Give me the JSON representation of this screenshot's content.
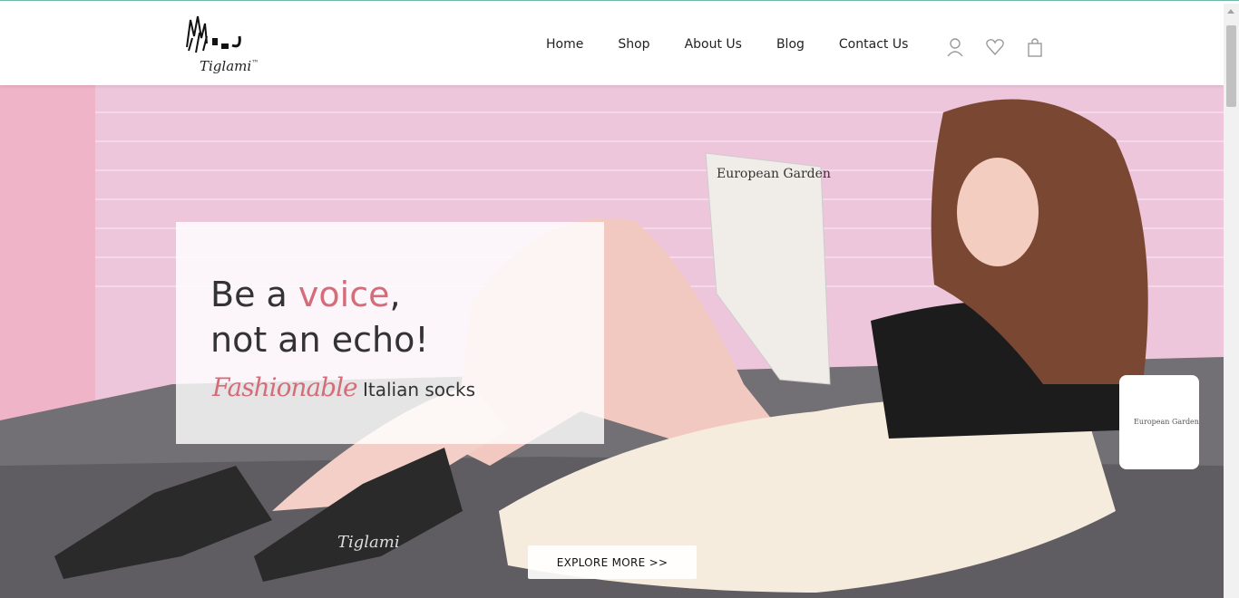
{
  "brand": {
    "logo_text": "Tiglami",
    "trademark": "™"
  },
  "nav": {
    "items": [
      {
        "label": "Home"
      },
      {
        "label": "Shop"
      },
      {
        "label": "About Us"
      },
      {
        "label": "Blog"
      },
      {
        "label": "Contact Us"
      }
    ],
    "icons": [
      "user-icon",
      "heart-icon",
      "shopping-bag-icon"
    ]
  },
  "hero": {
    "headline_part1": "Be a ",
    "headline_accent": "voice",
    "headline_part2": ",",
    "headline_line2": "not an echo!",
    "tagline_script": "Fashionable",
    "tagline_rest": " Italian socks",
    "cta_label": "EXPLORE MORE >>",
    "magazine_title": "European Garden",
    "mug_text": "European Garden",
    "sock_brand": "Tiglami"
  },
  "colors": {
    "accent": "#d46d79",
    "wall": "#eec6dc",
    "sofa": "#727075",
    "text": "#333333"
  }
}
